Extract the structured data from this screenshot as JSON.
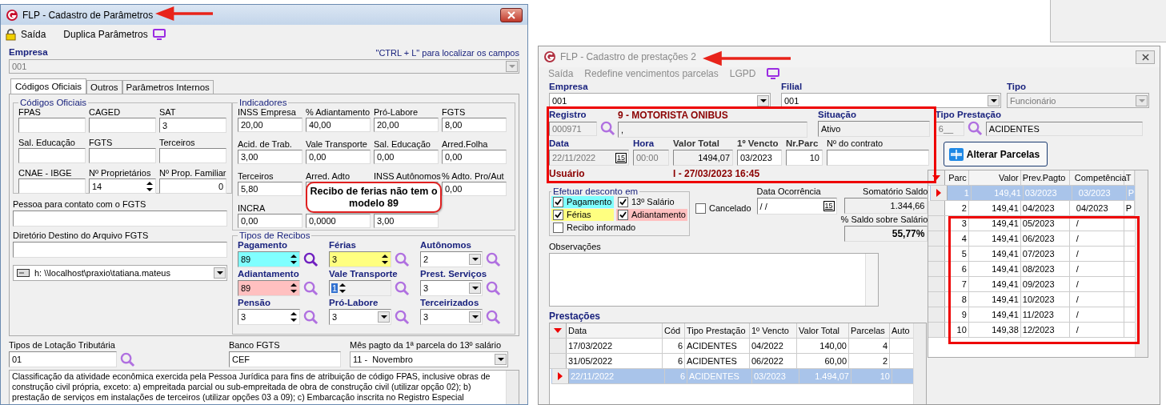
{
  "params_window": {
    "title": "FLP - Cadastro de Parâmetros",
    "menu": [
      {
        "label": "Saída",
        "kind": "lock"
      },
      {
        "label": "Duplica Parâmetros",
        "kind": "monitor"
      }
    ],
    "empresa": {
      "label": "Empresa",
      "hint": "\"CTRL + L\" para localizar os campos",
      "value": "001"
    },
    "tabs": [
      {
        "label": "Códigos Oficiais",
        "selected": true
      },
      {
        "label": "Outros",
        "selected": false
      },
      {
        "label": "Parâmetros Internos",
        "selected": false
      }
    ],
    "codigos": {
      "title": "Códigos Oficiais",
      "fields": [
        {
          "label": "FPAS",
          "kind": "text"
        },
        {
          "label": "CAGED",
          "kind": "text"
        },
        {
          "label": "SAT",
          "value": "3",
          "kind": "text"
        },
        {
          "label": "Sal. Educação",
          "kind": "text"
        },
        {
          "label": "FGTS",
          "kind": "text"
        },
        {
          "label": "Terceiros",
          "kind": "text"
        },
        {
          "label": "CNAE - IBGE",
          "kind": "text"
        },
        {
          "label": "Nº Proprietários",
          "value": "14",
          "kind": "spin"
        },
        {
          "label": "Nº Prop. Familiar",
          "value": "0",
          "kind": "number"
        }
      ]
    },
    "contato_label": "Pessoa para contato com o FGTS",
    "diretorio_label": "Diretório Destino do Arquivo FGTS",
    "path": "h: \\\\localhost\\praxio\\tatiana.mateus",
    "indicadores": {
      "title": "Indicadores",
      "fields": [
        {
          "label": "INSS Empresa",
          "value": "20,00"
        },
        {
          "label": "% Adiantamento",
          "value": "40,00"
        },
        {
          "label": "Pró-Labore",
          "value": "20,00"
        },
        {
          "label": "FGTS",
          "value": "8,00"
        },
        {
          "label": "Acid. de Trab.",
          "value": "3,00"
        },
        {
          "label": "Vale Transporte",
          "value": "0,00"
        },
        {
          "label": "Sal. Educação",
          "value": "0,00"
        },
        {
          "label": "Arred.Folha",
          "value": "0,00"
        },
        {
          "label": "Terceiros",
          "value": "5,80"
        },
        {
          "label": "Arred. Adto"
        },
        {
          "label": "INSS Autônomos"
        },
        {
          "label": "% Adto. Pro/Aut",
          "value": "0,00"
        },
        {
          "label": "INCRA",
          "value": "0,00"
        },
        {
          "value": "0,0000"
        },
        {
          "value": "3,00"
        }
      ]
    },
    "recibos": {
      "title": "Tipos de Recibos",
      "items": [
        {
          "label": "Pagamento",
          "value": "89",
          "kind": "spin",
          "color": "#80ffff",
          "disabled": false,
          "focused": false
        },
        {
          "label": "Férias",
          "value": "3",
          "kind": "spin",
          "color": "#ffff80",
          "disabled": false,
          "focused": false
        },
        {
          "label": "Autônomos",
          "value": "2",
          "kind": "combo",
          "disabled": false,
          "focused": false
        },
        {
          "label": "Adiantamento",
          "value": "89",
          "kind": "spin",
          "color": "#ffc0c0",
          "disabled": false,
          "focused": false
        },
        {
          "label": "Vale Transporte",
          "value": "1",
          "kind": "spin",
          "disabled": true,
          "focused": true
        },
        {
          "label": "Prest. Serviços",
          "value": "3",
          "kind": "combo",
          "disabled": false,
          "focused": false
        },
        {
          "label": "Pensão",
          "value": "3",
          "kind": "spin",
          "disabled": false,
          "focused": false
        },
        {
          "label": "Pró-Labore",
          "value": "3",
          "kind": "combo",
          "disabled": false,
          "focused": false
        },
        {
          "label": "Terceirizados",
          "value": "3",
          "kind": "combo",
          "disabled": false,
          "focused": false
        }
      ]
    },
    "lotacao": {
      "label": "Tipos de Lotação Tributária",
      "value": "01"
    },
    "banco": {
      "label": "Banco FGTS",
      "value": "CEF"
    },
    "mes": {
      "label": "Mês pagto da 1ª parcela do 13º salário",
      "value": "11 -  Novembro"
    },
    "description": "Classificação da atividade econômica exercida pela Pessoa Jurídica para fins de atribuição de código FPAS, inclusive obras de construção civil própria, exceto: a) empreitada parcial ou sub-empreitada de obra de construção civil (utilizar opção 02); b) prestação de serviços em instalações de terceiros (utilizar opções 03 a 09); c) Embarcação inscrita no Registro Especial"
  },
  "prest_window": {
    "title": "FLP - Cadastro de prestações 2",
    "menu": [
      "Saída",
      "Redefine vencimentos parcelas",
      "LGPD"
    ],
    "empresa": {
      "label": "Empresa",
      "value": "001"
    },
    "filial": {
      "label": "Filial",
      "value": "001"
    },
    "tipo": {
      "label": "Tipo",
      "value": "Funcionário"
    },
    "registro": {
      "label": "Registro",
      "value": "000971",
      "name": "9 - MOTORISTA ONIBUS",
      "name_field": ","
    },
    "situacao": {
      "label": "Situação",
      "value": "Ativo"
    },
    "tipo_prestacao": {
      "label": "Tipo Prestação",
      "code": "6__",
      "value": "ACIDENTES"
    },
    "data": {
      "label": "Data",
      "value": "22/11/2022",
      "calendar": "15"
    },
    "hora": {
      "label": "Hora",
      "value": "00:00"
    },
    "valor_total": {
      "label": "Valor Total",
      "value": "1494,07"
    },
    "vencto": {
      "label": "1º Vencto",
      "value": "03/2023"
    },
    "nr_parc": {
      "label": "Nr.Parc",
      "value": "10"
    },
    "contrato": {
      "label": "Nº do contrato"
    },
    "usuario": {
      "label": "Usuário",
      "value": "I - 27/03/2023 16:45"
    },
    "alterar_button": "Alterar Parcelas",
    "desconto": {
      "title": "Efetuar desconto em",
      "items": [
        {
          "label": "Pagamento",
          "checked": true,
          "color": "#80ffff"
        },
        {
          "label": "13º Salário",
          "checked": true
        },
        {
          "label": "Férias",
          "checked": true,
          "color": "#ffff80"
        },
        {
          "label": "Adiantamento",
          "checked": true,
          "color": "#ffc0c0"
        },
        {
          "label": "Recibo informado",
          "checked": false
        }
      ]
    },
    "cancelado": {
      "label": "Cancelado",
      "checked": false
    },
    "ocorrencia": {
      "label": "Data Ocorrência",
      "value": " /  /",
      "calendar": "15"
    },
    "somatorio": {
      "label": "Somatório Saldo",
      "value": "1.344,66"
    },
    "saldo_pct": {
      "label": "% Saldo sobre Salário",
      "value": "55,77%"
    },
    "observacoes_label": "Observações",
    "prestacoes": {
      "title": "Prestações",
      "columns": [
        "Data",
        "Cód",
        "Tipo Prestação",
        "1º Vencto",
        "Valor Total",
        "Parcelas",
        "Auto"
      ],
      "rows": [
        {
          "cells": [
            "17/03/2022",
            "6",
            "ACIDENTES",
            "04/2022",
            "140,00",
            "4"
          ],
          "selected": false
        },
        {
          "cells": [
            "31/05/2022",
            "6",
            "ACIDENTES",
            "06/2022",
            "60,00",
            "2"
          ],
          "selected": false
        },
        {
          "cells": [
            "22/11/2022",
            "6",
            "ACIDENTES",
            "03/2023",
            "1.494,07",
            "10"
          ],
          "selected": true
        }
      ]
    },
    "parcelas": {
      "columns": [
        "Parc",
        "Valor",
        "Prev.Pagto",
        "Competência",
        "T"
      ],
      "rows": [
        {
          "cells": [
            "1",
            "149,41",
            "03/2023",
            "03/2023",
            "P"
          ],
          "selected": true
        },
        {
          "cells": [
            "2",
            "149,41",
            "04/2023",
            "04/2023",
            "P"
          ],
          "selected": false
        },
        {
          "cells": [
            "3",
            "149,41",
            "05/2023",
            "/"
          ],
          "selected": false
        },
        {
          "cells": [
            "4",
            "149,41",
            "06/2023",
            "/"
          ],
          "selected": false
        },
        {
          "cells": [
            "5",
            "149,41",
            "07/2023",
            "/"
          ],
          "selected": false
        },
        {
          "cells": [
            "6",
            "149,41",
            "08/2023",
            "/"
          ],
          "selected": false
        },
        {
          "cells": [
            "7",
            "149,41",
            "09/2023",
            "/"
          ],
          "selected": false
        },
        {
          "cells": [
            "8",
            "149,41",
            "10/2023",
            "/"
          ],
          "selected": false
        },
        {
          "cells": [
            "9",
            "149,41",
            "11/2023",
            "/"
          ],
          "selected": false
        },
        {
          "cells": [
            "10",
            "149,38",
            "12/2023",
            "/"
          ],
          "selected": false
        }
      ]
    }
  },
  "callout": "Recibo de ferias não tem o modelo 89"
}
